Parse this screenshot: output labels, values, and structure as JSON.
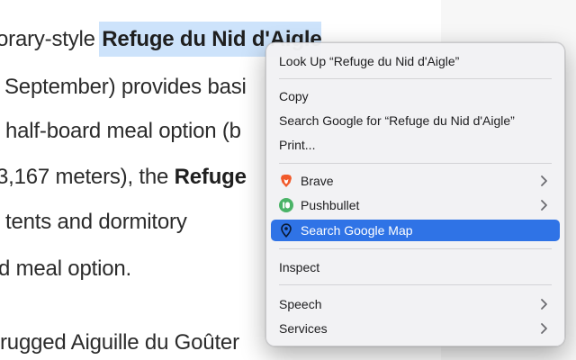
{
  "article": {
    "lines": [
      {
        "pre": "orary-style ",
        "selected": "Refuge du Nid d'Aigle",
        "post": ""
      },
      {
        "pre": "September) provides basi",
        "selected": "",
        "post": ""
      },
      {
        "pre": "half-board meal option (b",
        "selected": "",
        "post": ""
      },
      {
        "pre": "3,167 meters), the ",
        "bold": "Refuge",
        "post": ""
      },
      {
        "pre": "tents and dormitory",
        "selected": "",
        "post": ""
      },
      {
        "pre": "d meal option.",
        "selected": "",
        "post": ""
      },
      {
        "pre": "rugged Aiguille du Goûter",
        "selected": "",
        "post": ""
      }
    ]
  },
  "context_menu": {
    "look_up": "Look Up “Refuge du Nid d'Aigle”",
    "copy": "Copy",
    "search_google": "Search Google for “Refuge du Nid d'Aigle”",
    "print": "Print...",
    "brave": "Brave",
    "pushbullet": "Pushbullet",
    "search_google_map": "Search Google Map",
    "inspect": "Inspect",
    "speech": "Speech",
    "services": "Services"
  },
  "colors": {
    "highlight": "#2f73e6",
    "selection": "#cde3fb",
    "brave": "#f15a2b",
    "pushbullet": "#4ab367"
  },
  "icons": {
    "brave": "brave-lion-icon",
    "pushbullet": "pushbullet-icon",
    "map": "map-pin-icon",
    "submenu": "chevron-right-icon"
  }
}
